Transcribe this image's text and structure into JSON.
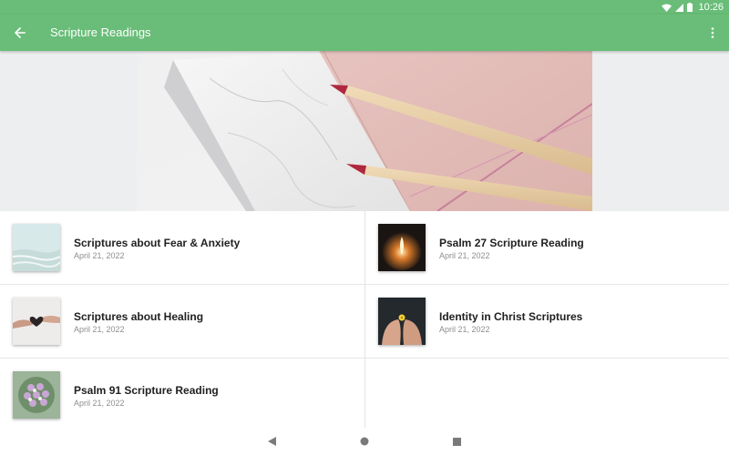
{
  "status_bar": {
    "time": "10:26",
    "icons": [
      "wifi-icon",
      "signal-icon",
      "battery-icon"
    ]
  },
  "app_bar": {
    "title": "Scripture Readings",
    "back_icon": "arrow-back-icon",
    "menu_icon": "more-vert-icon",
    "color": "#69bd78"
  },
  "hero": {
    "description_icon": "pencils-on-notebook-image"
  },
  "readings": [
    {
      "title": "Scriptures about Fear & Anxiety",
      "date": "April 21, 2022",
      "thumb": "water-shore-thumb"
    },
    {
      "title": "Psalm 27 Scripture Reading",
      "date": "April 21, 2022",
      "thumb": "candle-light-thumb"
    },
    {
      "title": "Scriptures about Healing",
      "date": "April 21, 2022",
      "thumb": "hands-heart-thumb"
    },
    {
      "title": "Identity in Christ Scriptures",
      "date": "April 21, 2022",
      "thumb": "open-hands-flower-thumb"
    },
    {
      "title": "Psalm 91 Scripture Reading",
      "date": "April 21, 2022",
      "thumb": "flower-bouquet-thumb"
    }
  ],
  "nav_bar": {
    "icons": [
      "back-triangle-icon",
      "home-circle-icon",
      "recents-square-icon"
    ]
  }
}
